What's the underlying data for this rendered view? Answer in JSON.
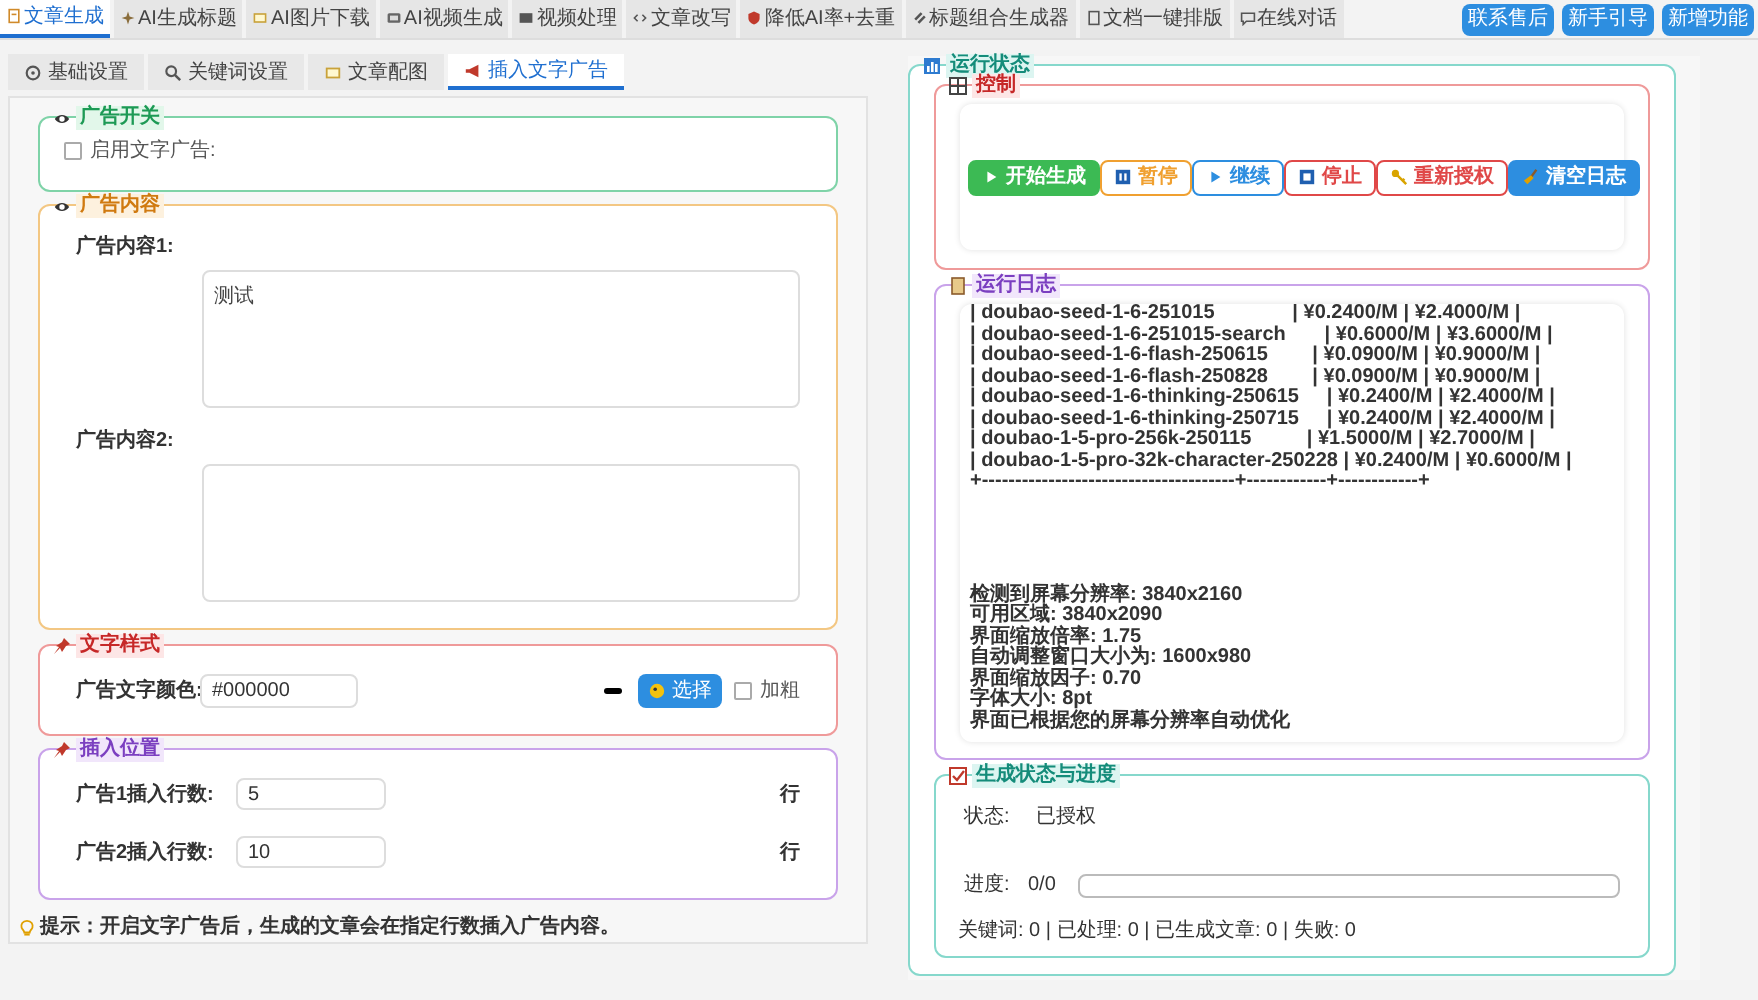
{
  "top_tabs": [
    {
      "label": "文章生成",
      "selected": true
    },
    {
      "label": "AI生成标题",
      "selected": false
    },
    {
      "label": "AI图片下载",
      "selected": false
    },
    {
      "label": "AI视频生成",
      "selected": false
    },
    {
      "label": "视频处理",
      "selected": false
    },
    {
      "label": "文章改写",
      "selected": false
    },
    {
      "label": "降低AI率+去重",
      "selected": false
    },
    {
      "label": "标题组合生成器",
      "selected": false
    },
    {
      "label": "文档一键排版",
      "selected": false
    },
    {
      "label": "在线对话",
      "selected": false
    }
  ],
  "top_buttons": [
    "联系售后",
    "新手引导",
    "新增功能"
  ],
  "sub_tabs": [
    {
      "label": "基础设置",
      "selected": false
    },
    {
      "label": "关键词设置",
      "selected": false
    },
    {
      "label": "文章配图",
      "selected": false
    },
    {
      "label": "插入文字广告",
      "selected": true
    }
  ],
  "ad_switch": {
    "title": "广告开关",
    "checkbox": {
      "label": "启用文字广告:",
      "checked": false
    }
  },
  "ad_content": {
    "title": "广告内容",
    "fields": [
      {
        "label": "广告内容1:",
        "value": "测试"
      },
      {
        "label": "广告内容2:"
      }
    ]
  },
  "text_style": {
    "title": "文字样式",
    "label": "广告文字颜色:",
    "value": "#000000",
    "pick_button": "选择",
    "bold": {
      "label": "加粗",
      "checked": false
    }
  },
  "insert_position": {
    "title": "插入位置",
    "rows": [
      {
        "label": "广告1插入行数:",
        "value": "5",
        "unit": "行"
      },
      {
        "label": "广告2插入行数:",
        "value": "10",
        "unit": "行"
      }
    ]
  },
  "tip": "提示：开启文字广告后，生成的文章会在指定行数插入广告内容。",
  "run_status": {
    "title": "运行状态",
    "control": {
      "title": "控制",
      "buttons": [
        {
          "label": "开始生成",
          "color": "#3cba54",
          "filled": true
        },
        {
          "label": "暂停",
          "color": "#f0a030",
          "filled": false
        },
        {
          "label": "继续",
          "color": "#2d8ee0",
          "filled": false
        },
        {
          "label": "停止",
          "color": "#e04848",
          "filled": false
        },
        {
          "label": "重新授权",
          "color": "#e04848",
          "filled": false
        },
        {
          "label": "清空日志",
          "color": "#2d8ee0",
          "filled": true
        }
      ]
    },
    "log": {
      "title": "运行日志",
      "table_lines": [
        "| doubao-seed-1-6-251015              | ¥0.2400/M | ¥2.4000/M |",
        "| doubao-seed-1-6-251015-search       | ¥0.6000/M | ¥3.6000/M |",
        "| doubao-seed-1-6-flash-250615        | ¥0.0900/M | ¥0.9000/M |",
        "| doubao-seed-1-6-flash-250828        | ¥0.0900/M | ¥0.9000/M |",
        "| doubao-seed-1-6-thinking-250615     | ¥0.2400/M | ¥2.4000/M |",
        "| doubao-seed-1-6-thinking-250715     | ¥0.2400/M | ¥2.4000/M |",
        "| doubao-1-5-pro-256k-250115          | ¥1.5000/M | ¥2.7000/M |",
        "| doubao-1-5-pro-32k-character-250228 | ¥0.2400/M | ¥0.6000/M |",
        "+--------------------------------------+------------+------------+"
      ],
      "info_lines": [
        "检测到屏幕分辨率: 3840x2160",
        "可用区域: 3840x2090",
        "界面缩放倍率: 1.75",
        "自动调整窗口大小为: 1600x980",
        "界面缩放因子: 0.70",
        "字体大小: 8pt",
        "界面已根据您的屏幕分辨率自动优化"
      ]
    },
    "progress": {
      "title": "生成状态与进度",
      "status_label": "状态:",
      "status_value": "已授权",
      "progress_label": "进度:",
      "progress_value": "0/0",
      "level": 0,
      "stats": "关键词: 0 | 已处理: 0 | 已生成文章: 0 | 失败: 0"
    }
  }
}
